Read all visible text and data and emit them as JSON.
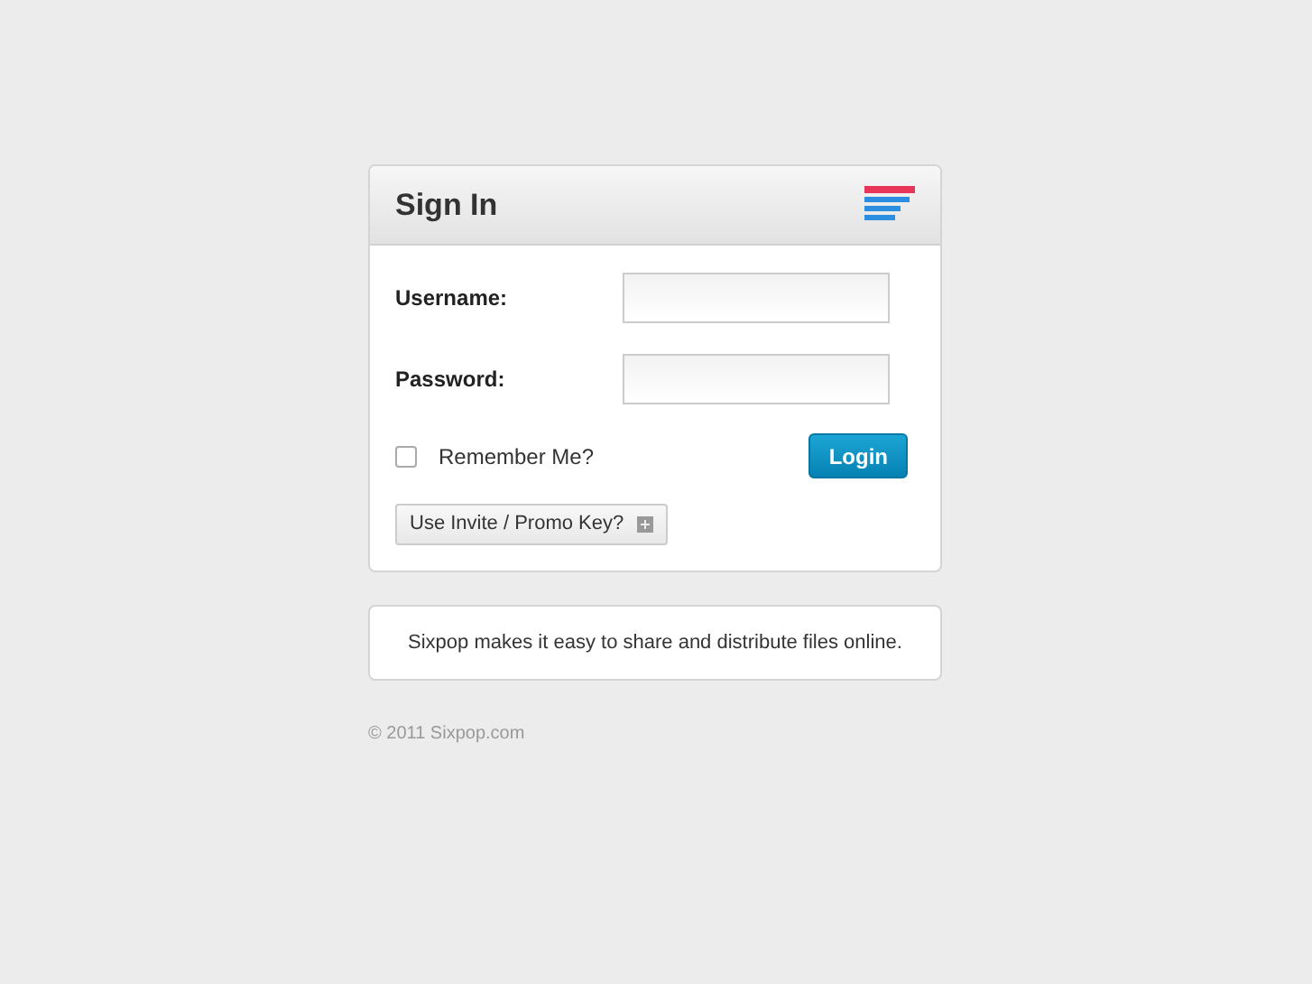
{
  "panel": {
    "title": "Sign In"
  },
  "fields": [
    {
      "label": "Username:"
    },
    {
      "label": "Password:"
    }
  ],
  "remember": {
    "label": "Remember Me?",
    "checked": false
  },
  "login_button": "Login",
  "invite_button": "Use Invite / Promo Key?",
  "tagline": "Sixpop makes it easy to share and distribute files online.",
  "footer": "© 2011 Sixpop.com"
}
